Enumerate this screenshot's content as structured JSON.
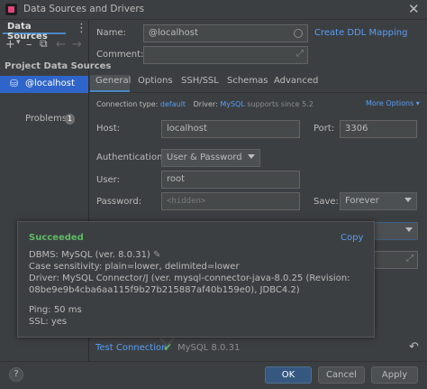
{
  "window": {
    "title": "Data Sources and Drivers"
  },
  "left": {
    "tab": "Data Sources",
    "section": "Project Data Sources",
    "item": "@localhost",
    "problems": {
      "label": "Problems",
      "count": "1"
    }
  },
  "form": {
    "name_label": "Name:",
    "name_value": "@localhost",
    "create_ddl": "Create DDL Mapping",
    "comment_label": "Comment:"
  },
  "tabs": [
    "General",
    "Options",
    "SSH/SSL",
    "Schemas",
    "Advanced"
  ],
  "connection": {
    "type_label": "Connection type:",
    "type_value": "default",
    "driver_label": "Driver:",
    "driver_value": "MySQL",
    "driver_note": "supports since 5.2",
    "more_options": "More Options"
  },
  "host": {
    "label": "Host:",
    "value": "localhost",
    "port_label": "Port:",
    "port_value": "3306"
  },
  "auth": {
    "label": "Authentication:",
    "value": "User & Password"
  },
  "user": {
    "label": "User:",
    "value": "root"
  },
  "password": {
    "label": "Password:",
    "placeholder": "<hidden>",
    "save_label": "Save:",
    "save_value": "Forever"
  },
  "popup": {
    "status": "Succeeded",
    "copy": "Copy",
    "lines": [
      "DBMS: MySQL (ver. 8.0.31)",
      "Case sensitivity: plain=lower, delimited=lower",
      "Driver: MySQL Connector/J (ver. mysql-connector-java-8.0.25 (Revision:",
      "08be9e9b4cba6aa115f9b27b215887af40b159e0), JDBC4.2)",
      "Ping: 50 ms",
      "SSL: yes"
    ]
  },
  "test": {
    "label": "Test Connection",
    "result": "MySQL 8.0.31"
  },
  "buttons": {
    "help": "?",
    "ok": "OK",
    "cancel": "Cancel",
    "apply": "Apply"
  },
  "colors": {
    "accent": "#4a88c7",
    "selection": "#2f65ca",
    "success": "#5fb865",
    "link": "#589df6",
    "ok_button": "#365880"
  }
}
